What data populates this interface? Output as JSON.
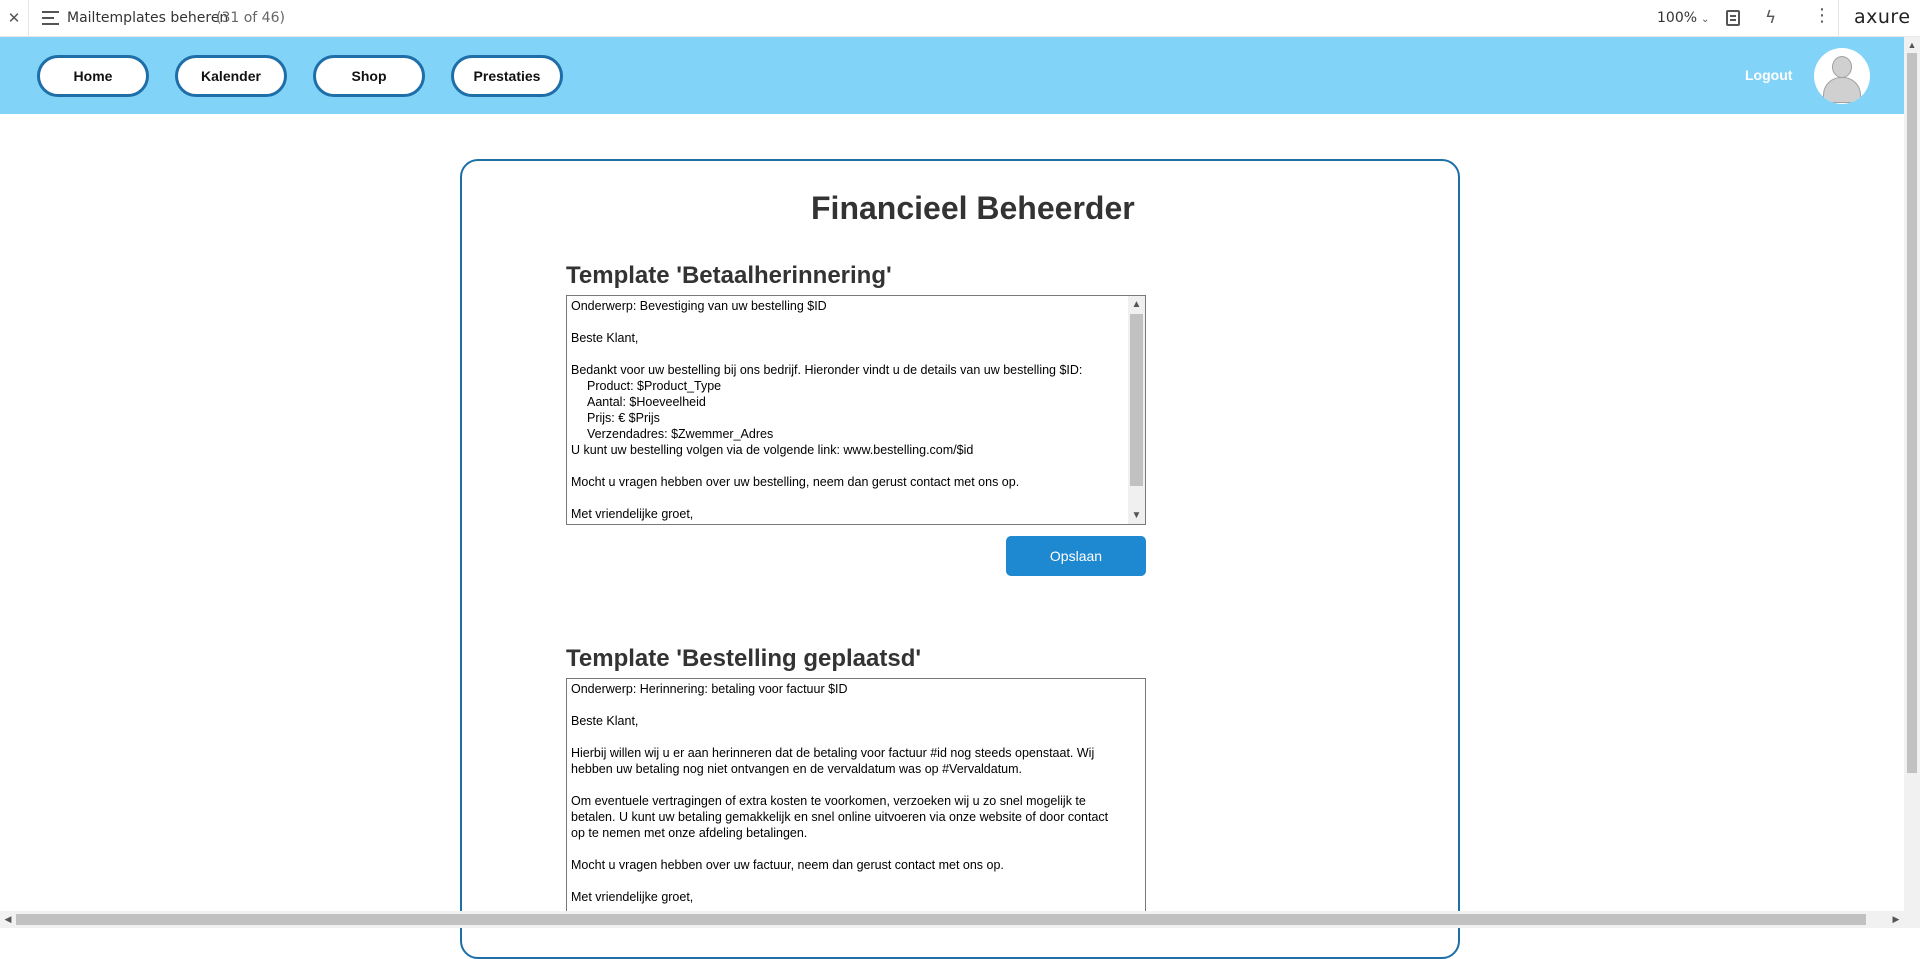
{
  "axure": {
    "close": "✕",
    "page_title": "Mailtemplates beheren",
    "page_count": "(31 of 46)",
    "zoom": "100%",
    "logo": "axure"
  },
  "nav": {
    "items": [
      {
        "label": "Home"
      },
      {
        "label": "Kalender"
      },
      {
        "label": "Shop"
      },
      {
        "label": "Prestaties"
      }
    ],
    "logout": "Logout"
  },
  "main": {
    "title": "Financieel Beheerder",
    "templates": [
      {
        "title": "Template 'Betaalherinnering'",
        "lines": [
          "Onderwerp: Bevestiging van uw bestelling $ID",
          "",
          "Beste Klant,",
          "",
          "Bedankt voor uw bestelling bij ons bedrijf. Hieronder vindt u de details van uw bestelling $ID:",
          "Product: $Product_Type",
          "Aantal: $Hoeveelheid",
          "Prijs: € $Prijs",
          "Verzendadres: $Zwemmer_Adres",
          "U kunt uw bestelling volgen via de volgende link: www.bestelling.com/$id",
          "",
          "Mocht u vragen hebben over uw bestelling, neem dan gerust contact met ons op.",
          "",
          "Met vriendelijke groet,"
        ],
        "save_label": "Opslaan"
      },
      {
        "title": "Template 'Bestelling geplaatsd'",
        "lines": [
          "Onderwerp: Herinnering: betaling voor factuur $ID",
          "",
          "Beste Klant,",
          "",
          "Hierbij willen wij u er aan herinneren dat de betaling voor factuur #id nog steeds openstaat. Wij",
          "hebben uw betaling nog niet ontvangen en de vervaldatum was op #Vervaldatum.",
          "",
          "Om eventuele vertragingen of extra kosten te voorkomen, verzoeken wij u zo snel mogelijk te",
          "betalen. U kunt uw betaling gemakkelijk en snel online uitvoeren via onze website of door contact",
          "op te nemen met onze afdeling betalingen.",
          "",
          "Mocht u vragen hebben over uw factuur, neem dan gerust contact met ons op.",
          "",
          "Met vriendelijke groet,"
        ]
      }
    ]
  },
  "colors": {
    "header_bg": "#81d3f8",
    "accent": "#1e6ea8",
    "button": "#1e88d0"
  }
}
